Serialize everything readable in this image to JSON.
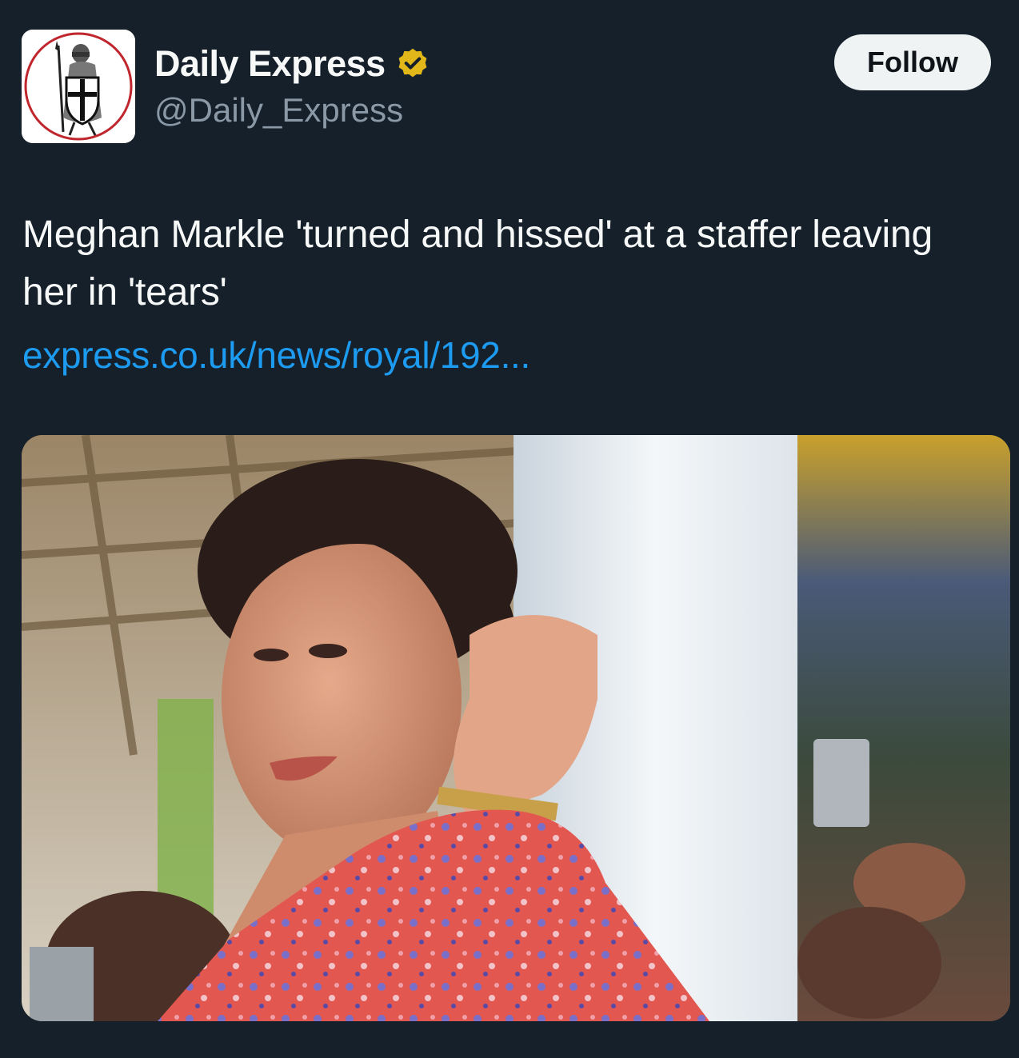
{
  "account": {
    "display_name": "Daily Express",
    "handle": "@Daily_Express",
    "avatar_icon": "crusader-knight-logo-icon",
    "verified_icon": "verified-badge-icon",
    "verified_color": "#e2b719"
  },
  "actions": {
    "follow_label": "Follow"
  },
  "tweet": {
    "text": "Meghan Markle 'turned and hissed' at a staffer leaving her in 'tears'",
    "link_text": "express.co.uk/news/royal/192..."
  },
  "media": {
    "image_icon": "article-photo-image"
  },
  "colors": {
    "background": "#15202b",
    "link": "#1d9bf0",
    "secondary_text": "#8b98a5",
    "button_bg": "#eff3f4"
  }
}
